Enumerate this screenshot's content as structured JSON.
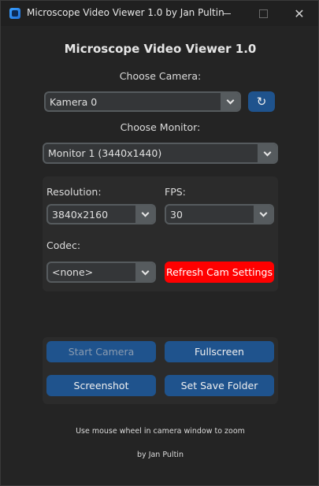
{
  "window": {
    "title": "Microscope Video Viewer 1.0 by Jan Pultin",
    "close_glyph": "✕"
  },
  "app": {
    "heading": "Microscope Video Viewer 1.0"
  },
  "camera": {
    "label": "Choose Camera:",
    "selected": "Kamera 0",
    "refresh_glyph": "↻"
  },
  "monitor": {
    "label": "Choose Monitor:",
    "selected": "Monitor 1 (3440x1440)"
  },
  "settings": {
    "resolution_label": "Resolution:",
    "resolution_value": "3840x2160",
    "fps_label": "FPS:",
    "fps_value": "30",
    "codec_label": "Codec:",
    "codec_value": "<none>",
    "refresh_button": "Refresh Cam Settings"
  },
  "actions": {
    "start_camera": "Start Camera",
    "fullscreen": "Fullscreen",
    "screenshot": "Screenshot",
    "set_save_folder": "Set Save Folder"
  },
  "footer": {
    "hint": "Use mouse wheel in camera window to zoom",
    "credit": "by Jan Pultin"
  },
  "colors": {
    "accent_blue": "#1f538d",
    "refresh_red": "#ff0000",
    "combo_bg": "#343638",
    "combo_border": "#565b5e",
    "panel_bg": "#2b2b2b",
    "window_bg": "#242424"
  }
}
